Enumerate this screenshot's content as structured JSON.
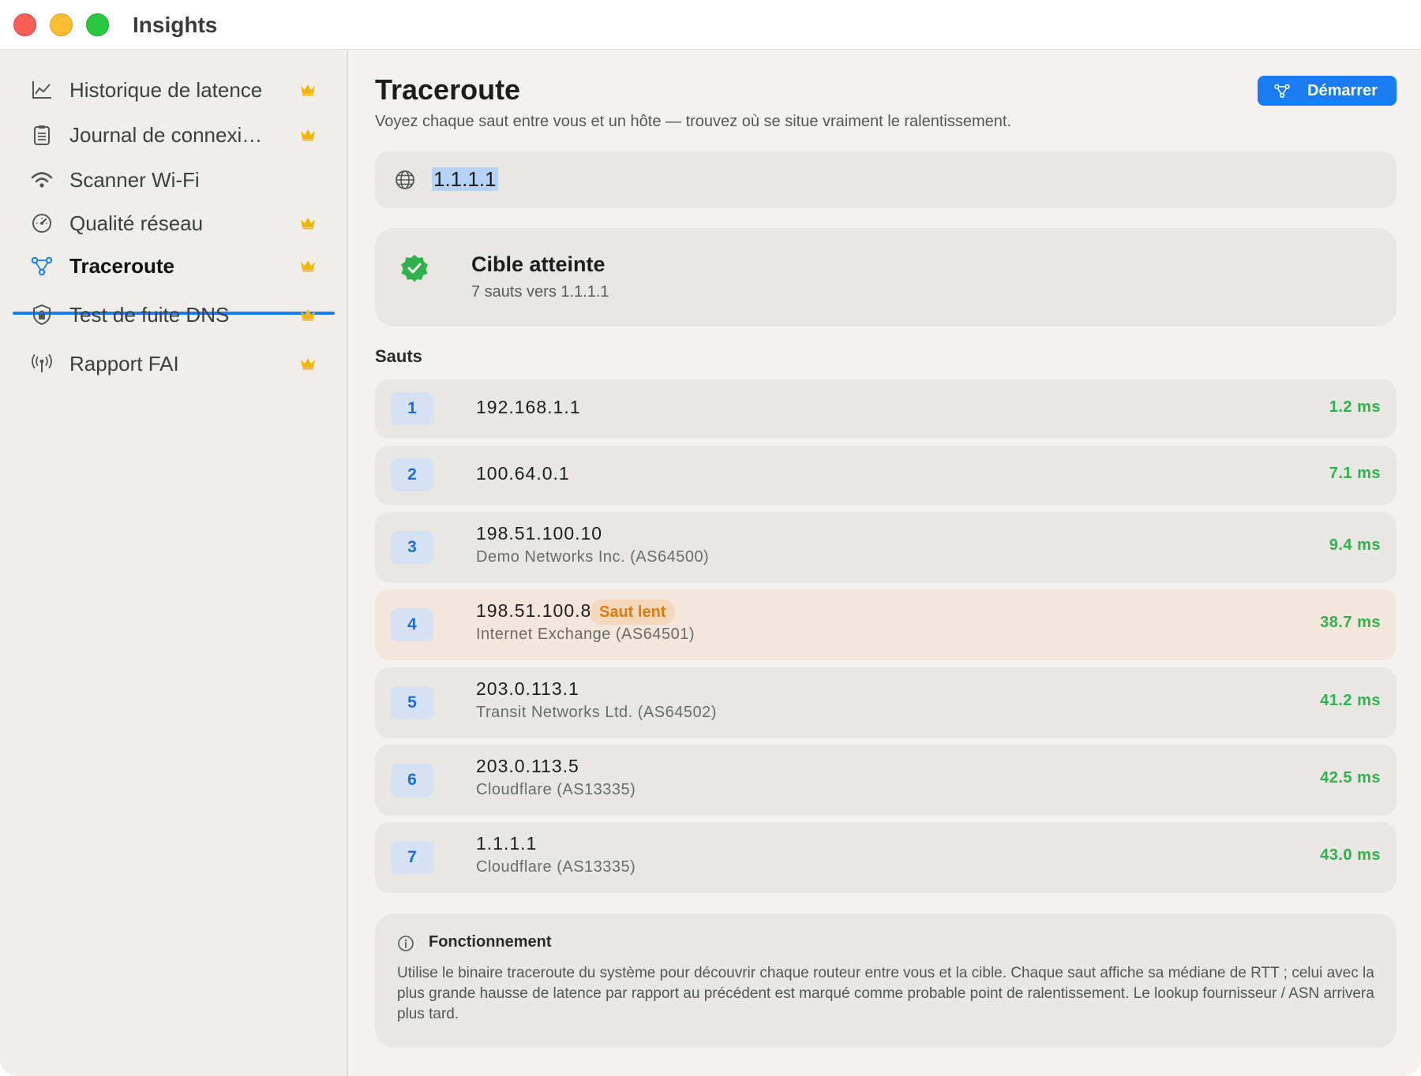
{
  "window": {
    "title": "Insights"
  },
  "sidebar": {
    "items": [
      {
        "label": "Historique de latence",
        "icon": "chart-line-icon",
        "premium": true
      },
      {
        "label": "Journal de connexi…",
        "icon": "clipboard-icon",
        "premium": true
      },
      {
        "label": "Scanner Wi-Fi",
        "icon": "wifi-icon",
        "premium": false
      },
      {
        "label": "Qualité réseau",
        "icon": "gauge-icon",
        "premium": true
      },
      {
        "label": "Traceroute",
        "icon": "traceroute-icon",
        "premium": true,
        "active": true
      },
      {
        "label": "Test de fuite DNS",
        "icon": "shield-lock-icon",
        "premium": true
      },
      {
        "label": "Rapport FAI",
        "icon": "antenna-icon",
        "premium": true
      }
    ]
  },
  "header": {
    "title": "Traceroute",
    "subtitle": "Voyez chaque saut entre vous et un hôte — trouvez où se situe vraiment le ralentissement.",
    "start_label": "Démarrer"
  },
  "target": {
    "value": "1.1.1.1"
  },
  "status": {
    "title": "Cible atteinte",
    "subtitle": "7 sauts vers 1.1.1.1"
  },
  "hops_title": "Sauts",
  "hops": [
    {
      "num": "1",
      "ip": "192.168.1.1",
      "org": "",
      "ms": "1.2 ms",
      "slow": false
    },
    {
      "num": "2",
      "ip": "100.64.0.1",
      "org": "",
      "ms": "7.1 ms",
      "slow": false
    },
    {
      "num": "3",
      "ip": "198.51.100.10",
      "org": "Demo Networks Inc. (AS64500)",
      "ms": "9.4 ms",
      "slow": false
    },
    {
      "num": "4",
      "ip": "198.51.100.84",
      "org": "Internet Exchange (AS64501)",
      "ms": "38.7 ms",
      "slow": true,
      "badge": "Saut lent"
    },
    {
      "num": "5",
      "ip": "203.0.113.1",
      "org": "Transit Networks Ltd. (AS64502)",
      "ms": "41.2 ms",
      "slow": false
    },
    {
      "num": "6",
      "ip": "203.0.113.5",
      "org": "Cloudflare (AS13335)",
      "ms": "42.5 ms",
      "slow": false
    },
    {
      "num": "7",
      "ip": "1.1.1.1",
      "org": "Cloudflare (AS13335)",
      "ms": "43.0 ms",
      "slow": false
    }
  ],
  "info": {
    "title": "Fonctionnement",
    "body": "Utilise le binaire traceroute du système pour découvrir chaque routeur entre vous et la cible. Chaque saut affiche sa médiane de RTT ; celui avec la plus grande hausse de latence par rapport au précédent est marqué comme probable point de ralentissement. Le lookup fournisseur / ASN arrivera plus tard."
  },
  "colors": {
    "accent": "#1a7cf2",
    "success": "#2fb14c",
    "crown": "#f2b705",
    "slow_bg": "#f4e6da",
    "slow_text": "#de7b0c"
  }
}
